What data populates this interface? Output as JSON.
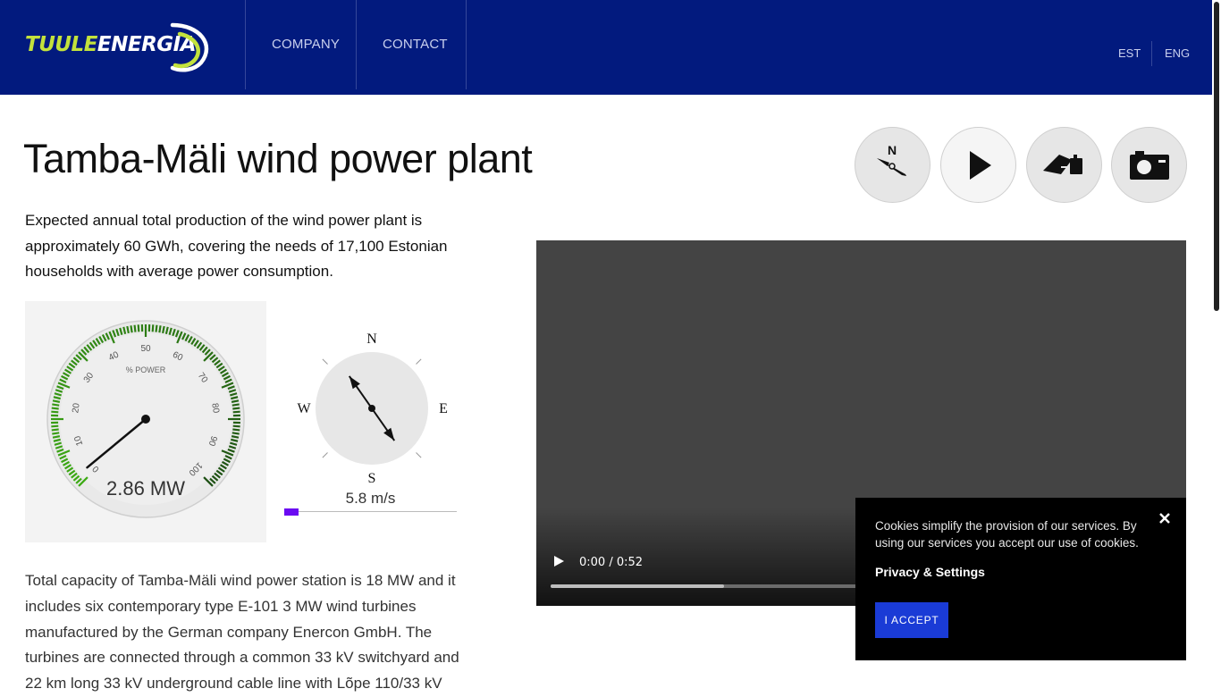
{
  "header": {
    "logo": {
      "part1": "TUULE",
      "part2": "ENERGIA"
    },
    "nav": [
      {
        "label": "COMPANY"
      },
      {
        "label": "CONTACT"
      }
    ],
    "languages": [
      {
        "label": "EST"
      },
      {
        "label": "ENG"
      }
    ]
  },
  "page": {
    "title": "Tamba-Mäli wind power plant",
    "lead": "Expected annual total production of the wind power plant is approximately 60 GWh, covering the needs of 17,100 Estonian households with average power consumption.",
    "body": "Total capacity of Tamba-Mäli wind power station is 18 MW and it includes six contemporary type E-101 3 MW wind turbines manufactured by the German company Enercon GmbH. The turbines are connected through a common 33 kV switchyard and 22 km long 33 kV underground cable line with Lõpe 110/33 kV"
  },
  "toolbar": {
    "buttons": [
      {
        "icon": "compass-icon"
      },
      {
        "icon": "play-icon"
      },
      {
        "icon": "drone-icon"
      },
      {
        "icon": "camera-icon"
      }
    ]
  },
  "gauge": {
    "label": "% POWER",
    "ticks": [
      "0",
      "10",
      "20",
      "30",
      "40",
      "50",
      "60",
      "70",
      "80",
      "90",
      "100"
    ],
    "needle_percent": 2,
    "value_text": "2.86 MW"
  },
  "wind": {
    "cardinals": {
      "n": "N",
      "e": "E",
      "s": "S",
      "w": "W"
    },
    "direction_deg": 325,
    "speed_text": "5.8 m/s",
    "speed_fraction": 0.08
  },
  "video": {
    "time_text": "0:00 / 0:52",
    "buffered_fraction": 0.28
  },
  "cookie": {
    "text": "Cookies simplify the provision of our services. By using our services you accept our use of cookies.",
    "link": "Privacy & Settings",
    "accept": "I ACCEPT"
  },
  "colors": {
    "header_bg": "#021a7e",
    "logo_accent": "#c3e23c",
    "accept_button": "#1a3bd6",
    "speed_fill": "#6a0af2"
  }
}
